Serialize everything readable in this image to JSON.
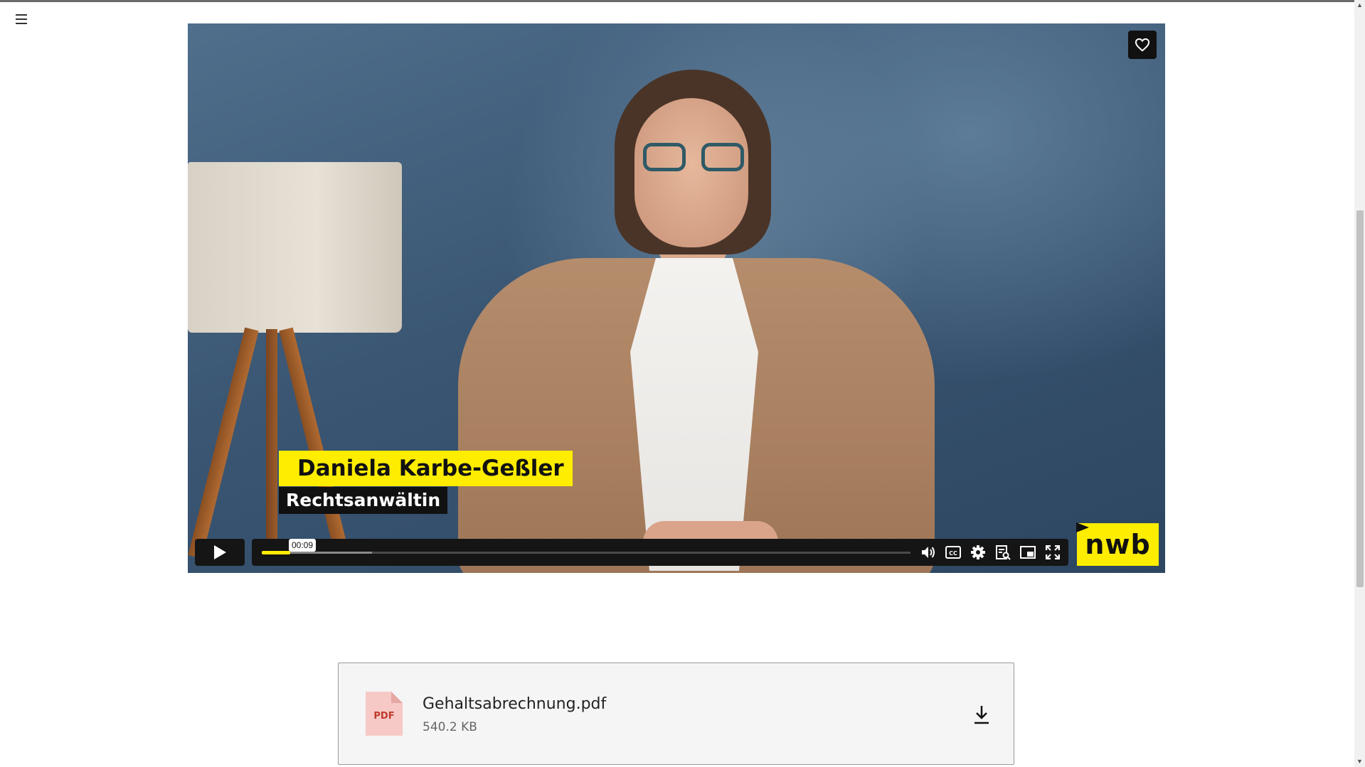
{
  "video": {
    "speaker_name": "Daniela Karbe-Geßler",
    "speaker_role": "Rechtsanwältin",
    "time_tooltip": "00:09",
    "progress": {
      "played_fraction": 0.044,
      "buffered_fraction": 0.17
    },
    "logo_text": "nwb",
    "icons": [
      "heart-icon",
      "play-icon",
      "volume-icon",
      "closed-captions-icon",
      "settings-icon",
      "transcript-search-icon",
      "picture-in-picture-icon",
      "fullscreen-icon"
    ],
    "accent_color": "#ffed00"
  },
  "attachment": {
    "file_name": "Gehaltsabrechnung.pdf",
    "file_size": "540.2 KB",
    "file_type_label": "PDF",
    "icons": [
      "pdf-file-icon",
      "download-icon"
    ]
  },
  "page": {
    "icons": [
      "hamburger-menu-icon"
    ]
  }
}
